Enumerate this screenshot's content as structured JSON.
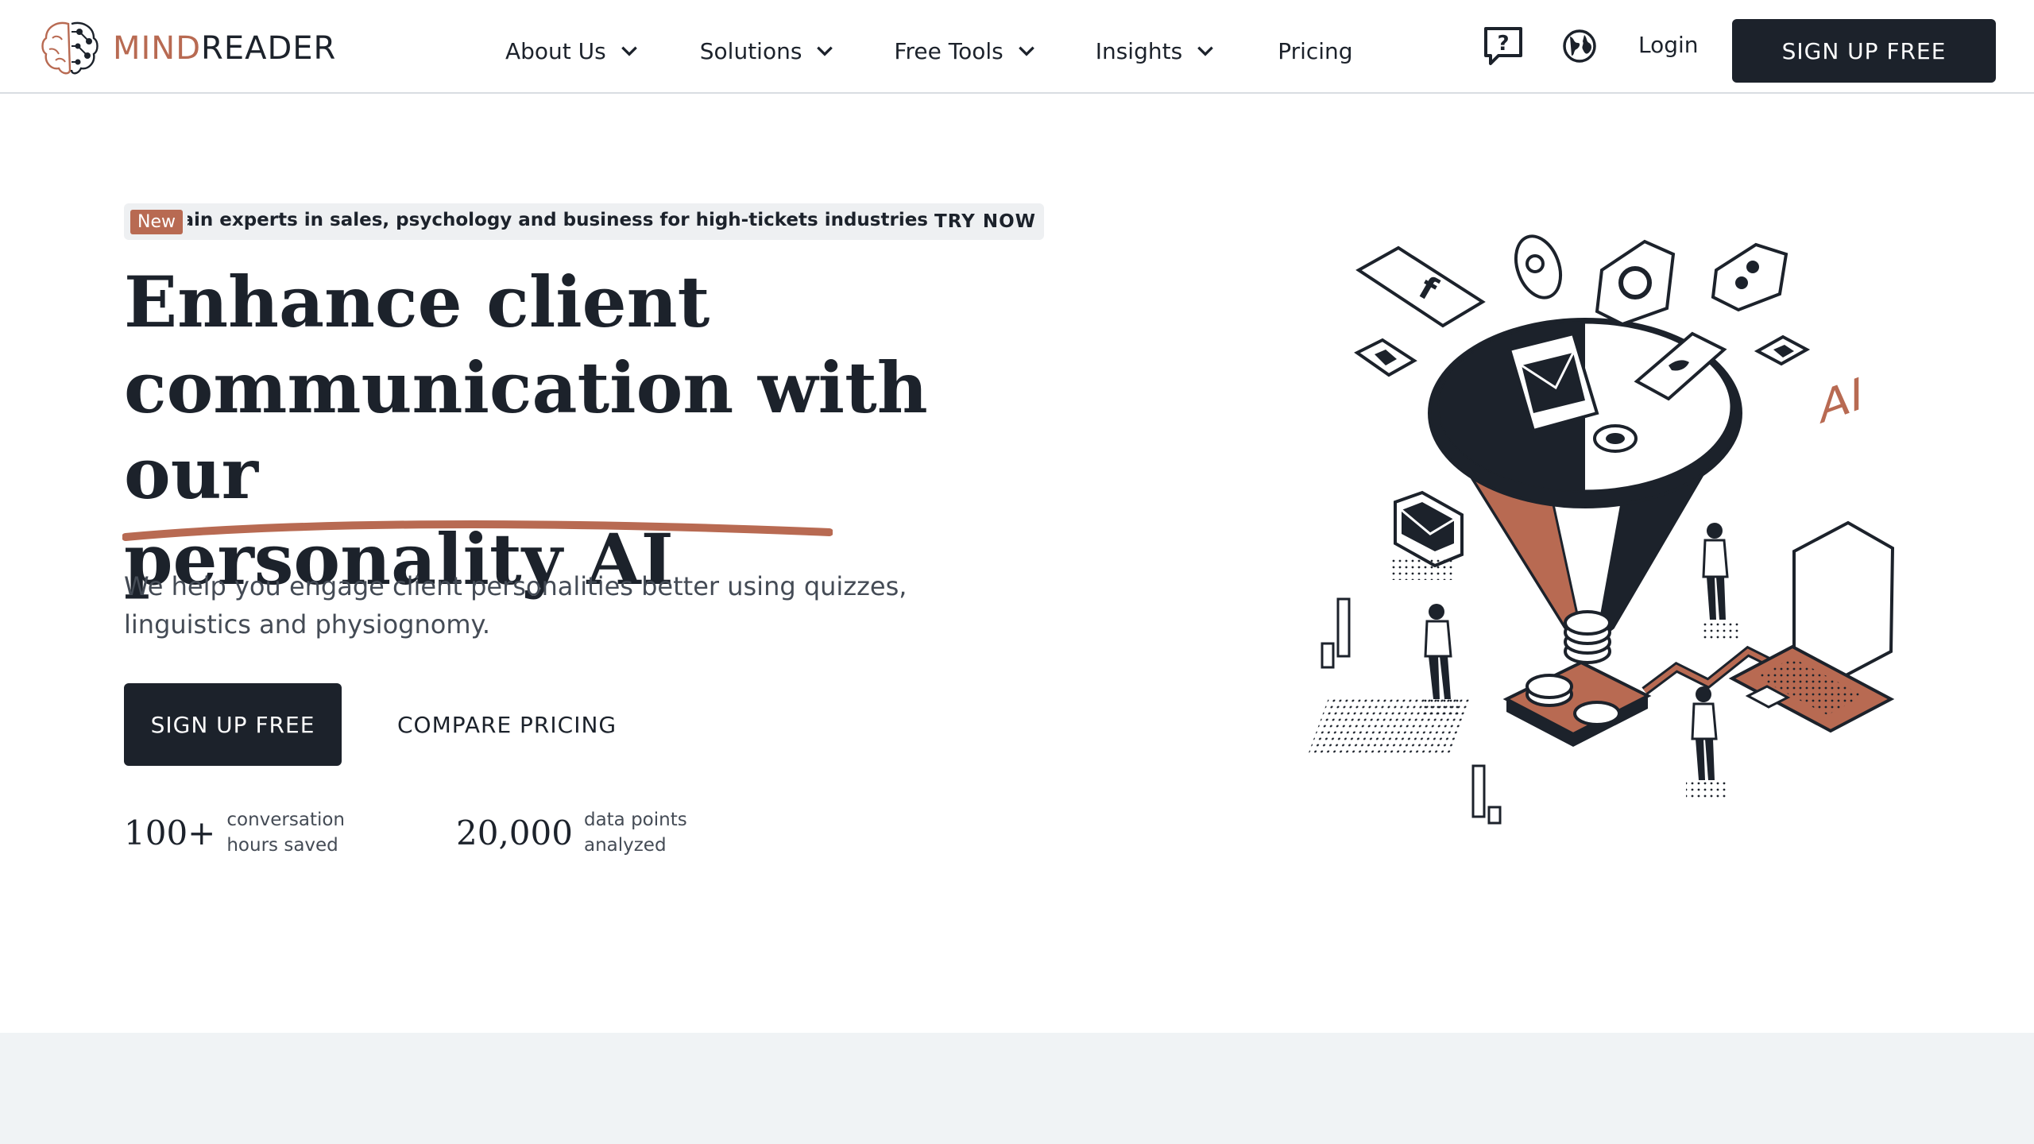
{
  "brand": {
    "name_part1": "MIND",
    "name_part2": "READER",
    "accent_color": "#b86a52",
    "dark_color": "#1c222b"
  },
  "nav": {
    "items": [
      {
        "label": "About Us",
        "has_dropdown": true
      },
      {
        "label": "Solutions",
        "has_dropdown": true
      },
      {
        "label": "Free Tools",
        "has_dropdown": true
      },
      {
        "label": "Insights",
        "has_dropdown": true
      },
      {
        "label": "Pricing",
        "has_dropdown": false
      }
    ],
    "icons": [
      "help-icon",
      "globe-icon"
    ],
    "login_label": "Login",
    "cta_label": "SIGN UP FREE"
  },
  "announcement": {
    "badge": "New",
    "text": "ned from domain experts in sales, psychology and business for high-tickets industries",
    "action": "TRY NOW"
  },
  "hero": {
    "title_line1": "Enhance client",
    "title_line2": "communication with our",
    "title_line3": "personality AI",
    "subtitle": "We help you engage client personalities better using quizzes, linguistics and physiognomy.",
    "primary_cta": "SIGN UP FREE",
    "secondary_cta": "COMPARE PRICING"
  },
  "stats": [
    {
      "value": "100+",
      "label": "conversation hours saved"
    },
    {
      "value": "20,000",
      "label": "data points analyzed"
    }
  ],
  "illustration": {
    "laptop_text": "AI",
    "icons": [
      "facebook-icon",
      "twitter-icon",
      "instagram-icon",
      "mail-icon",
      "chat-icon"
    ]
  }
}
